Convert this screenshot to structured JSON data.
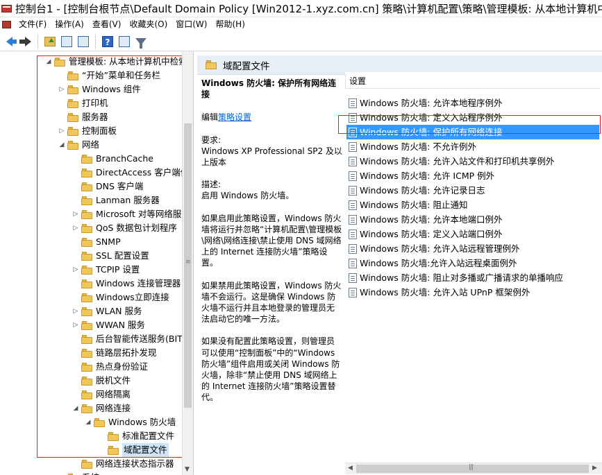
{
  "window": {
    "title": "控制台1 - [控制台根节点\\Default Domain Policy [Win2012-1.xyz.com.cn] 策略\\计算机配置\\策略\\管理模板: 从本地计算机中检"
  },
  "menu": {
    "items": [
      "文件(F)",
      "操作(A)",
      "查看(V)",
      "收藏夹(O)",
      "窗口(W)",
      "帮助(H)"
    ]
  },
  "tree": {
    "items": [
      {
        "label": "管理模板: 从本地计算机中检索",
        "expander": "◢"
      },
      {
        "label": "“开始”菜单和任务栏",
        "expander": ""
      },
      {
        "label": "Windows 组件",
        "expander": "▷"
      },
      {
        "label": "打印机",
        "expander": ""
      },
      {
        "label": "服务器",
        "expander": ""
      },
      {
        "label": "控制面板",
        "expander": "▷"
      },
      {
        "label": "网络",
        "expander": "◢"
      },
      {
        "label": "BranchCache",
        "expander": ""
      },
      {
        "label": "DirectAccess 客户端体",
        "expander": ""
      },
      {
        "label": "DNS 客户端",
        "expander": ""
      },
      {
        "label": "Lanman 服务器",
        "expander": ""
      },
      {
        "label": "Microsoft 对等网络服务",
        "expander": "▷"
      },
      {
        "label": "QoS 数据包计划程序",
        "expander": "▷"
      },
      {
        "label": "SNMP",
        "expander": ""
      },
      {
        "label": "SSL 配置设置",
        "expander": ""
      },
      {
        "label": "TCPIP 设置",
        "expander": "▷"
      },
      {
        "label": "Windows 连接管理器",
        "expander": ""
      },
      {
        "label": "Windows立即连接",
        "expander": ""
      },
      {
        "label": "WLAN 服务",
        "expander": "▷"
      },
      {
        "label": "WWAN 服务",
        "expander": "▷"
      },
      {
        "label": "后台智能传送服务(BITS",
        "expander": ""
      },
      {
        "label": "链路层拓扑发现",
        "expander": ""
      },
      {
        "label": "热点身份验证",
        "expander": ""
      },
      {
        "label": "脱机文件",
        "expander": ""
      },
      {
        "label": "网络隔离",
        "expander": ""
      },
      {
        "label": "网络连接",
        "expander": "◢"
      },
      {
        "label": "Windows 防火墙",
        "expander": "◢"
      },
      {
        "label": "标准配置文件",
        "expander": ""
      },
      {
        "label": "域配置文件",
        "expander": ""
      },
      {
        "label": "网络连接状态指示器",
        "expander": ""
      },
      {
        "label": "系统",
        "expander": "▷"
      }
    ]
  },
  "right": {
    "header_title": "域配置文件",
    "description": {
      "title": "Windows 防火墙: 保护所有网络连接",
      "edit_prefix": "编辑",
      "edit_link": "策略设置",
      "requirements": "要求:\nWindows XP Professional SP2 及以上版本",
      "desc_label": "描述:\n启用 Windows 防火墙。",
      "p_enable": "如果启用此策略设置，Windows 防火墙将运行并忽略“计算机配置\\管理模板\\网络\\网络连接\\禁止使用 DNS 域网络上的 Internet 连接防火墙”策略设置。",
      "p_disable": "如果禁用此策略设置，Windows 防火墙不会运行。这是确保 Windows 防火墙不运行并且本地登录的管理员无法启动它的唯一方法。",
      "p_notconfig": "如果没有配置此策略设置，则管理员可以使用“控制面板”中的“Windows 防火墙”组件启用或关闭 Windows 防火墙，除非“禁止使用 DNS 域网络上的 Internet 连接防火墙”策略设置替代。"
    },
    "list_header": "设置",
    "settings": [
      "Windows 防火墙: 允许本地程序例外",
      "Windows 防火墙: 定义入站程序例外",
      "Windows 防火墙: 保护所有网络连接",
      "Windows 防火墙: 不允许例外",
      "Windows 防火墙: 允许入站文件和打印机共享例外",
      "Windows 防火墙: 允许 ICMP 例外",
      "Windows 防火墙: 允许记录日志",
      "Windows 防火墙: 阻止通知",
      "Windows 防火墙: 允许本地端口例外",
      "Windows 防火墙: 定义入站端口例外",
      "Windows 防火墙: 允许入站远程管理例外",
      "Windows 防火墙:允许入站远程桌面例外",
      "Windows 防火墙: 阻止对多播或广播请求的单播响应",
      "Windows 防火墙: 允许入站 UPnP 框架例外"
    ],
    "selected_index": 2
  }
}
